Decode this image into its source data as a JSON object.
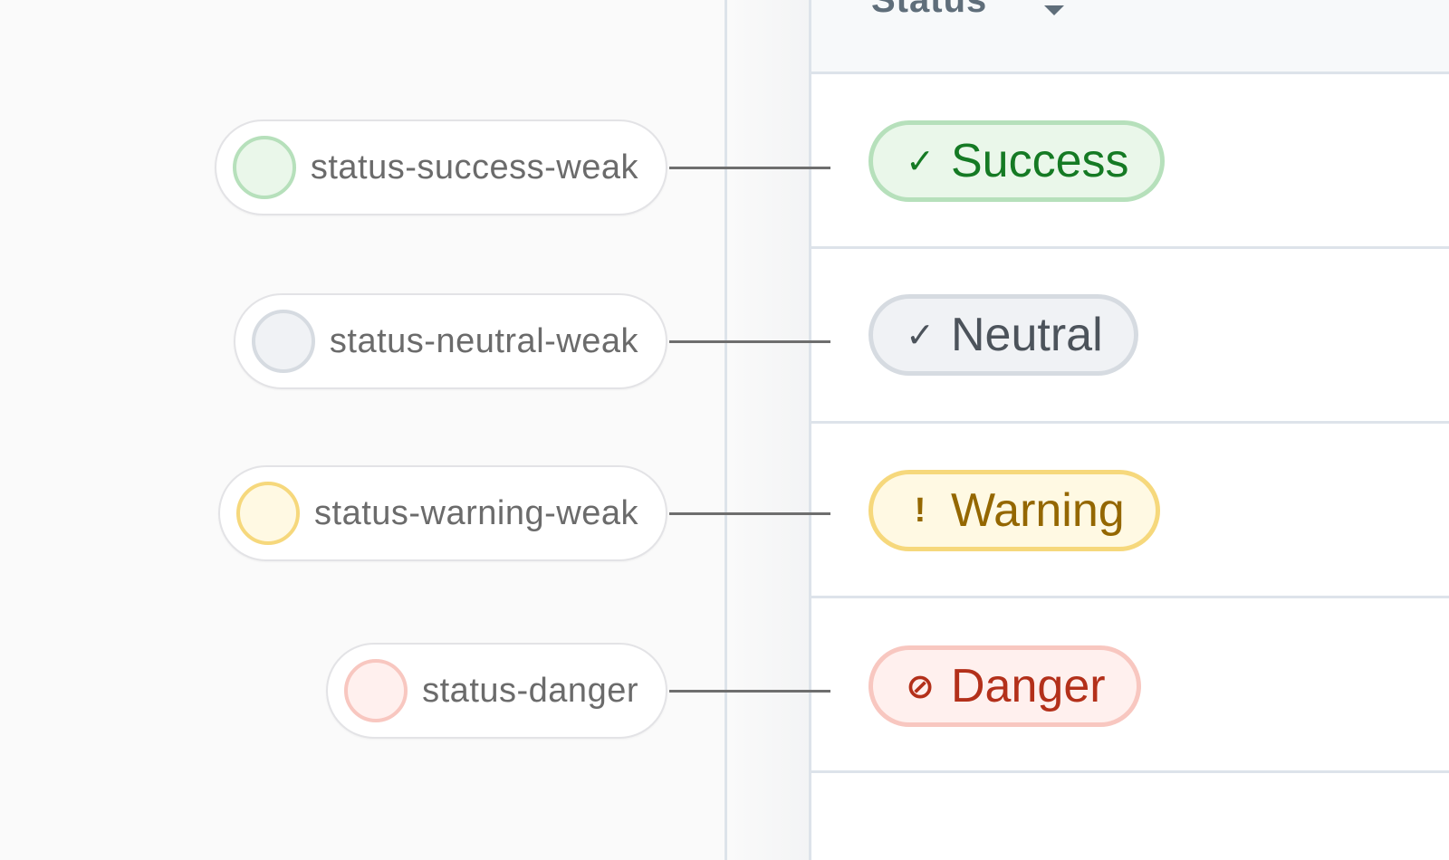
{
  "table": {
    "header": {
      "label": "Status",
      "icon": "caret-down-icon"
    }
  },
  "rows": [
    {
      "token": "status-success-weak",
      "badge": "Success",
      "icon": "check-icon",
      "glyph": "✓",
      "fill": "#eaf7ea",
      "border": "#b6e0bb",
      "text_color": "#157a24"
    },
    {
      "token": "status-neutral-weak",
      "badge": "Neutral",
      "icon": "check-icon",
      "glyph": "✓",
      "fill": "#f0f2f5",
      "border": "#d6dbe1",
      "text_color": "#4c535b"
    },
    {
      "token": "status-warning-weak",
      "badge": "Warning",
      "icon": "exclamation-icon",
      "glyph": "!",
      "fill": "#fff9e3",
      "border": "#f6d87c",
      "text_color": "#946700"
    },
    {
      "token": "status-danger",
      "badge": "Danger",
      "icon": "prohibited-icon",
      "glyph": "⊘",
      "fill": "#fff0ee",
      "border": "#f8c7c0",
      "text_color": "#b3301a"
    }
  ]
}
